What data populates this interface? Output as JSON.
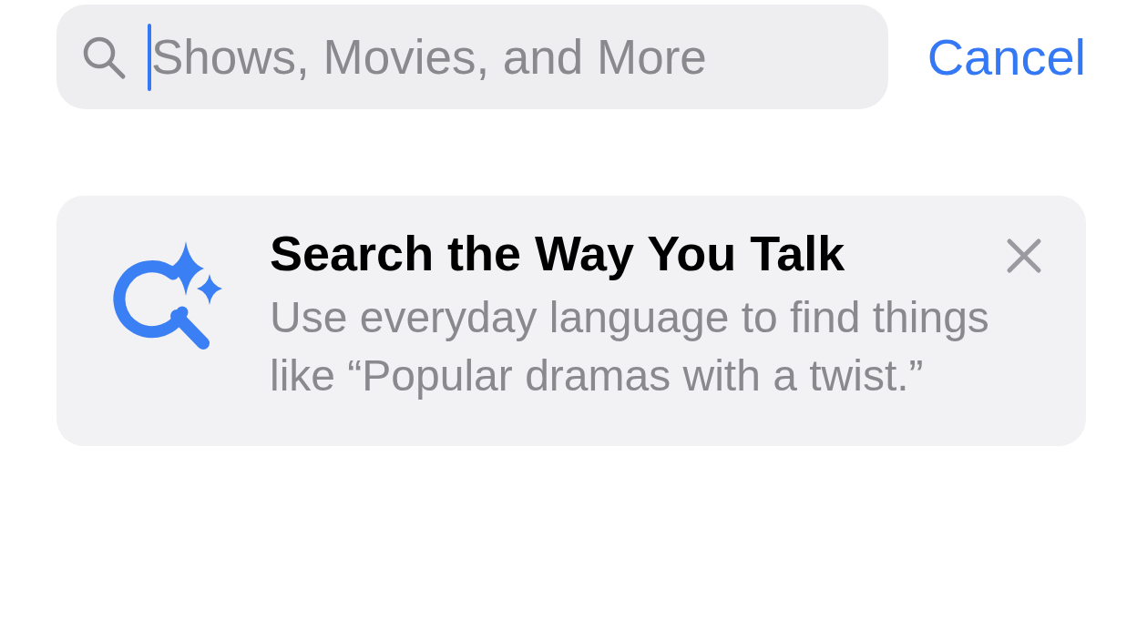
{
  "search": {
    "placeholder": "Shows, Movies, and More",
    "focused": true
  },
  "cancel": "Cancel",
  "tip": {
    "title": "Search the Way You Talk",
    "body": "Use everyday language to find things like “Popular dramas with a twist.”"
  }
}
